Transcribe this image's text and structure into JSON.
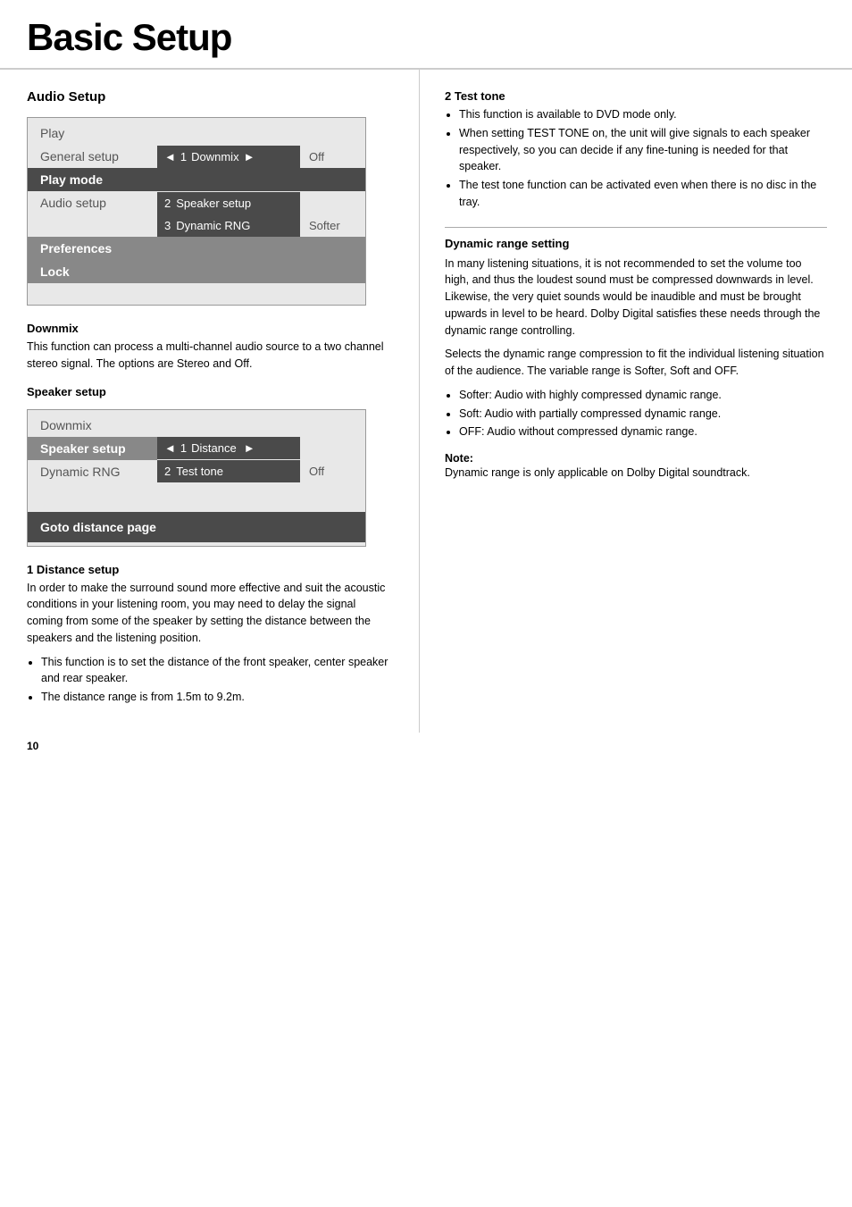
{
  "header": {
    "title": "Basic Setup"
  },
  "left": {
    "audio_setup_title": "Audio Setup",
    "menu1": {
      "items": [
        {
          "label": "Play",
          "state": "normal"
        },
        {
          "label": "General setup",
          "state": "normal",
          "has_control": true,
          "control_num": "1",
          "control_text": "Downmix",
          "arrow_left": "◄",
          "arrow_right": "►",
          "value": "Off"
        },
        {
          "label": "Play mode",
          "state": "active"
        },
        {
          "label": "Audio setup",
          "state": "normal",
          "has_sub": true,
          "sub_num": "2",
          "sub_text": "Speaker setup"
        },
        {
          "label": "",
          "state": "normal",
          "has_sub2": true,
          "sub_num": "3",
          "sub_text": "Dynamic RNG",
          "value": "Softer"
        },
        {
          "label": "Preferences",
          "state": "normal"
        },
        {
          "label": "Lock",
          "state": "normal"
        }
      ]
    },
    "downmix_heading": "Downmix",
    "downmix_text": "This function can process a multi-channel audio source to a two channel stereo signal. The options are Stereo and Off.",
    "speaker_setup_heading": "Speaker setup",
    "menu2": {
      "items": [
        {
          "label": "Downmix",
          "state": "normal"
        },
        {
          "label": "Speaker setup",
          "state": "active",
          "has_control": true,
          "control_num": "1",
          "control_text": "Distance",
          "arrow_left": "◄",
          "arrow_right": "►"
        },
        {
          "label": "Dynamic RNG",
          "state": "normal",
          "has_control": true,
          "control_num": "2",
          "control_text": "Test tone",
          "value": "Off"
        }
      ],
      "goto_label": "Goto distance page"
    },
    "distance_heading": "1 Distance setup",
    "distance_text": "In order to make the surround sound more effective and suit the acoustic conditions in your listening room, you may need to delay the signal coming from some of the speaker by setting the distance between the speakers and the listening position.",
    "distance_bullets": [
      "This function is to set the distance of the front speaker, center speaker and rear speaker.",
      "The distance range is from 1.5m to 9.2m."
    ]
  },
  "right": {
    "test_tone_heading": "2 Test tone",
    "test_tone_bullets": [
      "This function is available to DVD mode only.",
      "When setting TEST TONE on, the unit will give signals to each speaker respectively, so you can decide if any fine-tuning is needed for that speaker.",
      "The test tone function can be activated even when there is no disc in the tray."
    ],
    "dyn_range_heading": "Dynamic range setting",
    "dyn_range_text1": "In many listening situations, it is not recommended to set the volume too high, and thus the loudest sound must be compressed downwards in level. Likewise, the very quiet sounds would be inaudible and must be brought upwards in level to be heard. Dolby Digital satisfies these needs through the dynamic range controlling.",
    "dyn_range_text2": "Selects the dynamic range compression to fit the individual listening situation of the audience. The variable range is Softer, Soft and OFF.",
    "dyn_range_bullets": [
      "Softer: Audio with highly compressed dynamic range.",
      "Soft: Audio with partially compressed dynamic range.",
      "OFF: Audio without compressed dynamic range."
    ],
    "note_label": "Note:",
    "note_text": "Dynamic range is only applicable on Dolby Digital soundtrack."
  },
  "footer": {
    "page_number": "10"
  }
}
